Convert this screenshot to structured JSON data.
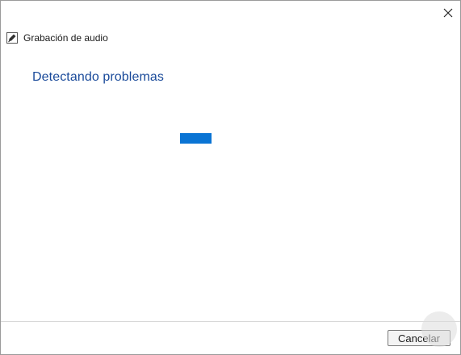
{
  "window": {
    "title": "Grabación de audio",
    "close_icon": "close-icon",
    "app_icon": "microphone-icon"
  },
  "main": {
    "heading": "Detectando problemas",
    "progress_state": "indeterminate"
  },
  "footer": {
    "cancel_label": "Cancelar"
  },
  "colors": {
    "heading": "#1a4a9a",
    "progress": "#0a74d4",
    "footer_border": "#d8d8d8"
  }
}
